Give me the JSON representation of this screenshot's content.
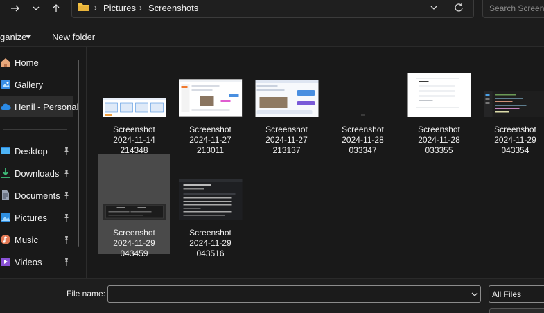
{
  "address": {
    "breadcrumbs": [
      "Pictures",
      "Screenshots"
    ]
  },
  "search": {
    "placeholder": "Search Screenshots"
  },
  "toolbar": {
    "organize_label": "ganize",
    "new_folder_label": "New folder"
  },
  "sidebar": {
    "items": [
      {
        "label": "Home",
        "icon": "home-icon",
        "pinned": false
      },
      {
        "label": "Gallery",
        "icon": "gallery-icon",
        "pinned": false
      },
      {
        "label": "Henil - Personal",
        "icon": "cloud-icon",
        "pinned": false,
        "active": true
      },
      {
        "label": "Desktop",
        "icon": "desktop-icon",
        "pinned": true
      },
      {
        "label": "Downloads",
        "icon": "download-icon",
        "pinned": true
      },
      {
        "label": "Documents",
        "icon": "documents-icon",
        "pinned": true
      },
      {
        "label": "Pictures",
        "icon": "pictures-icon",
        "pinned": true
      },
      {
        "label": "Music",
        "icon": "music-icon",
        "pinned": true
      },
      {
        "label": "Videos",
        "icon": "videos-icon",
        "pinned": true
      }
    ]
  },
  "files": [
    {
      "line1": "Screenshot",
      "line2": "2024-11-14",
      "line3": "214348",
      "thumb": "light"
    },
    {
      "line1": "Screenshot",
      "line2": "2024-11-27",
      "line3": "213011",
      "thumb": "light"
    },
    {
      "line1": "Screenshot",
      "line2": "2024-11-27",
      "line3": "213137",
      "thumb": "light"
    },
    {
      "line1": "Screenshot",
      "line2": "2024-11-28",
      "line3": "033347",
      "thumb": "dark"
    },
    {
      "line1": "Screenshot",
      "line2": "2024-11-28",
      "line3": "033355",
      "thumb": "light"
    },
    {
      "line1": "Screenshot",
      "line2": "2024-11-29",
      "line3": "043354",
      "thumb": "dark"
    },
    {
      "line1": "Screenshot",
      "line2": "2024-11-29",
      "line3": "043459",
      "thumb": "dark",
      "selected": true
    },
    {
      "line1": "Screenshot",
      "line2": "2024-11-29",
      "line3": "043516",
      "thumb": "dark"
    }
  ],
  "footer": {
    "file_name_label": "File name:",
    "file_name_value": "",
    "file_type": "All Files"
  },
  "colors": {
    "background": "#191919",
    "selected_tile": "#4a4a4a",
    "folder_yellow": "#f3c243",
    "accent_blue": "#4aa0e6"
  }
}
